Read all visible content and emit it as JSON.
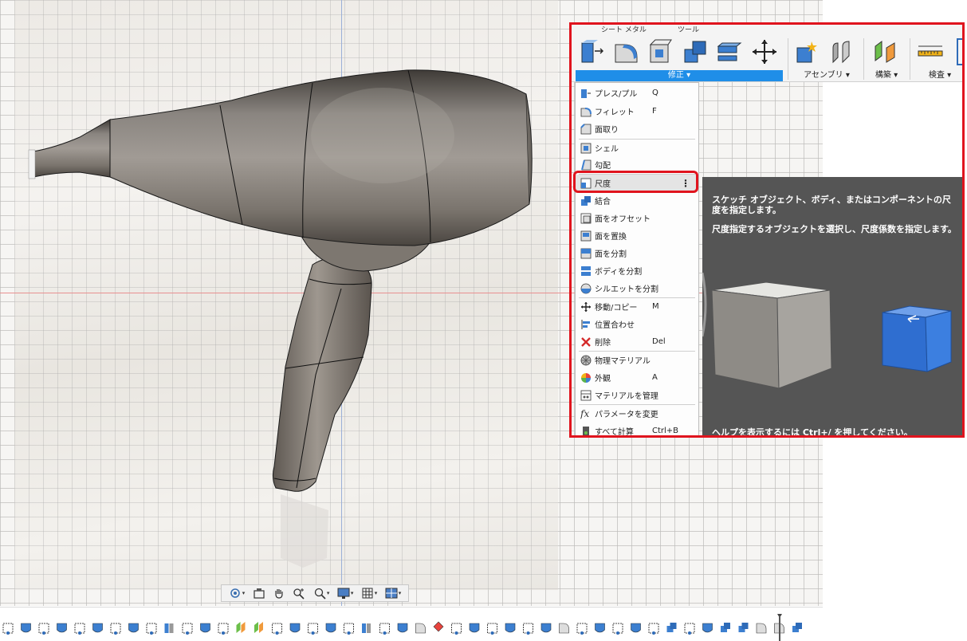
{
  "toolbar": {
    "tabs": [
      "シート メタル",
      "ツール"
    ],
    "groups": {
      "modify": "修正 ▾",
      "assemble": "アセンブリ ▾",
      "construct": "構築 ▾",
      "inspect": "検査 ▾"
    },
    "icons": [
      "press-pull-icon",
      "fillet-icon",
      "chamfer-icon",
      "combine-icon",
      "offset-face-icon",
      "move-icon",
      "new-component-icon",
      "joint-icon",
      "offset-plane-icon",
      "measure-icon"
    ]
  },
  "menu": {
    "items": [
      {
        "label": "プレス/プル",
        "shortcut": "Q"
      },
      {
        "label": "フィレット",
        "shortcut": "F"
      },
      {
        "label": "面取り",
        "shortcut": ""
      },
      {
        "label": "シェル",
        "shortcut": ""
      },
      {
        "label": "勾配",
        "shortcut": ""
      },
      {
        "label": "尺度",
        "shortcut": ""
      },
      {
        "label": "結合",
        "shortcut": ""
      },
      {
        "label": "面をオフセット",
        "shortcut": ""
      },
      {
        "label": "面を置換",
        "shortcut": ""
      },
      {
        "label": "面を分割",
        "shortcut": ""
      },
      {
        "label": "ボディを分割",
        "shortcut": ""
      },
      {
        "label": "シルエットを分割",
        "shortcut": ""
      },
      {
        "label": "移動/コピー",
        "shortcut": "M"
      },
      {
        "label": "位置合わせ",
        "shortcut": ""
      },
      {
        "label": "削除",
        "shortcut": "Del"
      },
      {
        "label": "物理マテリアル",
        "shortcut": ""
      },
      {
        "label": "外観",
        "shortcut": "A"
      },
      {
        "label": "マテリアルを管理",
        "shortcut": ""
      },
      {
        "label": "パラメータを変更",
        "shortcut": ""
      },
      {
        "label": "すべて計算",
        "shortcut": "Ctrl+B"
      }
    ],
    "more_glyph": "⋮"
  },
  "tooltip": {
    "line1": "スケッチ オブジェクト、ボディ、またはコンポーネントの尺度を指定します。",
    "line2": "尺度指定するオブジェクトを選択し、尺度係数を指定します。",
    "help": "ヘルプを表示するには Ctrl+/ を押してください。"
  },
  "navbar": {
    "icons": [
      "orbit-icon",
      "look-at-icon",
      "pan-icon",
      "zoom-icon",
      "zoom-window-icon",
      "display-settings-icon",
      "grid-settings-icon",
      "viewports-icon"
    ]
  },
  "colors": {
    "accent": "#1f8ee8",
    "highlight": "#e0141e",
    "tooltip_bg": "#555555"
  }
}
